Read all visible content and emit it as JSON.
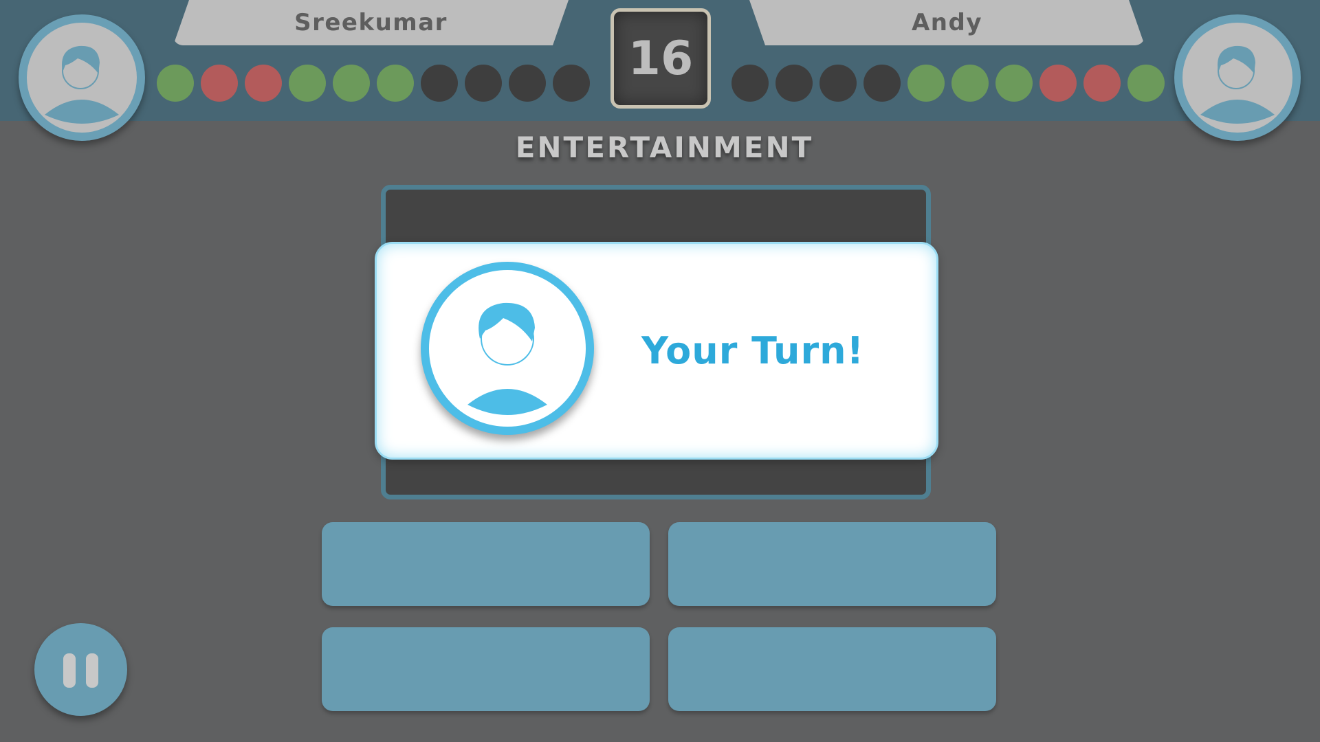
{
  "players": {
    "left": {
      "name": "Sreekumar",
      "results": [
        "correct",
        "wrong",
        "wrong",
        "correct",
        "correct",
        "correct",
        "pending",
        "pending",
        "pending",
        "pending"
      ]
    },
    "right": {
      "name": "Andy",
      "results": [
        "pending",
        "pending",
        "pending",
        "pending",
        "correct",
        "correct",
        "correct",
        "wrong",
        "wrong",
        "correct"
      ]
    }
  },
  "timer": {
    "value": "16"
  },
  "category": "ENTERTAINMENT",
  "turn": {
    "label": "Your Turn!"
  },
  "answers": [
    "",
    "",
    "",
    ""
  ],
  "colors": {
    "correct": "#6c9a5b",
    "wrong": "#b35b5b",
    "pending": "#3e3e3e",
    "accent": "#4dbde7",
    "answer_button": "#689cb1",
    "header": "#476674"
  },
  "icons": {
    "avatar": "user-avatar-icon",
    "pause": "pause-icon"
  }
}
